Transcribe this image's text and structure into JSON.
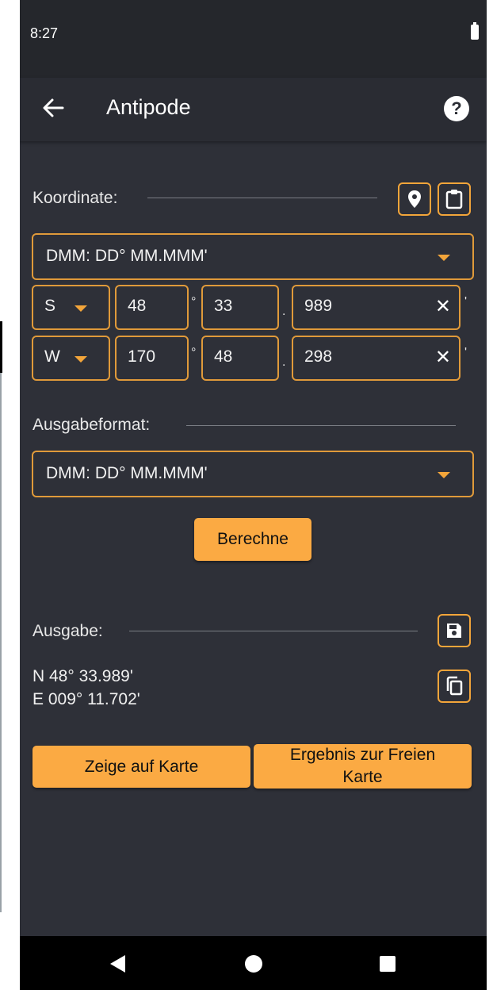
{
  "status": {
    "time": "8:27"
  },
  "appbar": {
    "title": "Antipode",
    "help_glyph": "?"
  },
  "icons": {
    "back": "arrow-back-icon",
    "help": "help-circle-icon",
    "location": "location-pin-icon",
    "paste": "clipboard-icon",
    "save": "save-icon",
    "copy": "copy-icon"
  },
  "input": {
    "label": "Koordinate:",
    "format": "DMM: DD° MM.MMM'",
    "lat": {
      "hemisphere": "S",
      "deg": "48",
      "min": "33",
      "dec": "989"
    },
    "lon": {
      "hemisphere": "W",
      "deg": "170",
      "min": "48",
      "dec": "298"
    },
    "deg_symbol": "°",
    "dot": ".",
    "min_symbol": "'",
    "clear_glyph": "✕"
  },
  "output_format": {
    "label": "Ausgabeformat:",
    "value": "DMM: DD° MM.MMM'"
  },
  "calculate_label": "Berechne",
  "output": {
    "label": "Ausgabe:",
    "line1": "N 48° 33.989'",
    "line2": "E 009° 11.702'"
  },
  "buttons": {
    "show_on_map": "Zeige auf Karte",
    "to_free_map": "Ergebnis zur Freien Karte"
  },
  "colors": {
    "accent": "#fbaa43",
    "background": "#2e3038",
    "appbar": "#2a2c33"
  }
}
